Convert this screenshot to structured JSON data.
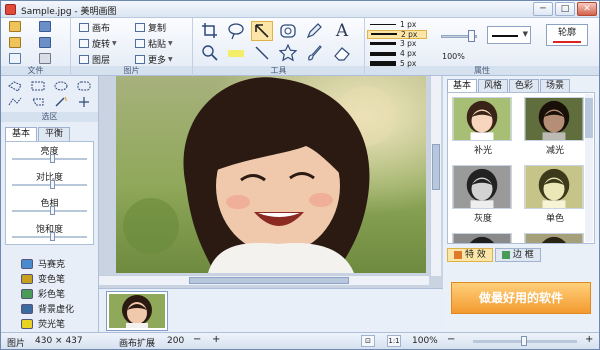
{
  "window": {
    "title": "Sample.jpg - 美明画图",
    "minimize": "─",
    "maximize": "□",
    "close": "✕"
  },
  "ribbon": {
    "file": {
      "label": "文件"
    },
    "image": {
      "label": "图片",
      "canvas": "画布",
      "rotate": "旋转",
      "layer": "图层",
      "copy": "复制",
      "paste": "粘贴",
      "more": "更多"
    },
    "tools": {
      "label": "工具",
      "icons": [
        "crop-icon",
        "lasso-icon",
        "arrow-select-icon",
        "rounded-rect-icon",
        "pen-icon",
        "text-icon",
        "magnifier-icon",
        "highlighter-icon",
        "line-icon",
        "star-icon",
        "brush-icon",
        "eraser-icon"
      ],
      "text_tool": "A"
    },
    "properties": {
      "label": "属性",
      "line_widths": [
        "1 px",
        "2 px",
        "3 px",
        "4 px",
        "5 px"
      ],
      "selected_width": "2 px",
      "zoom": "100%",
      "brush": "轮廓"
    }
  },
  "left_panel": {
    "selection_label": "选区",
    "tabs": [
      "基本",
      "平衡"
    ],
    "adjust": [
      {
        "label": "亮度",
        "level": 0.5
      },
      {
        "label": "对比度",
        "level": 0.5
      },
      {
        "label": "色相",
        "level": 0.5
      },
      {
        "label": "饱和度",
        "level": 0.5
      }
    ],
    "effects": [
      {
        "label": "马赛克",
        "color": "#4a8ad0"
      },
      {
        "label": "变色笔",
        "color": "#c8a020"
      },
      {
        "label": "彩色笔",
        "color": "#4a9a5a"
      },
      {
        "label": "背景虚化",
        "color": "#3a6aa0"
      },
      {
        "label": "荧光笔",
        "color": "#e8d420"
      }
    ]
  },
  "right_panel": {
    "tabs": [
      "基本",
      "风格",
      "色彩",
      "场景"
    ],
    "effects": [
      {
        "label": "补光"
      },
      {
        "label": "减光"
      },
      {
        "label": "灰度"
      },
      {
        "label": "单色"
      },
      {
        "label": "",
        "partial": true
      },
      {
        "label": "",
        "partial": true
      }
    ],
    "bottom_tabs": [
      "特 效",
      "边 框"
    ],
    "banner": "做最好用的软件"
  },
  "status": {
    "image_label": "图片",
    "image_size": "430 × 437",
    "canvas_label": "画布扩展",
    "canvas_value": "200",
    "minus": "−",
    "plus": "+",
    "zoom": "100%",
    "actual_size": "1:1"
  },
  "colors": {
    "accent": "#e0b24a",
    "frame": "#6f88b0",
    "banner": "#f39a2f"
  }
}
